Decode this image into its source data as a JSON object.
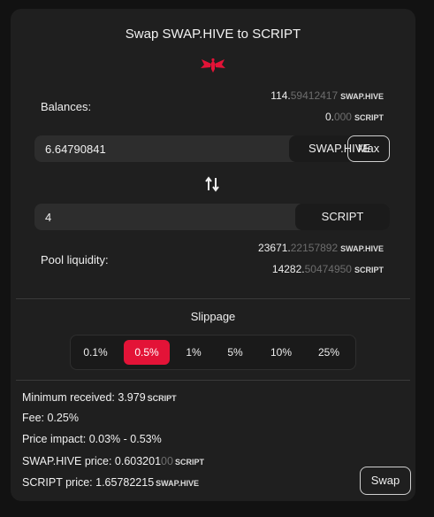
{
  "title": "Swap SWAP.HIVE to SCRIPT",
  "brand_color": "#e31337",
  "balances": {
    "label": "Balances:",
    "hive": {
      "int": "114.",
      "dec": "59412417",
      "unit": "SWAP.HIVE"
    },
    "script": {
      "int": "0.",
      "dec": "000",
      "unit": "SCRIPT"
    }
  },
  "from": {
    "value": "6.64790841",
    "token": "SWAP.HIVE",
    "max_label": "Max"
  },
  "swap_icon": "swap-vertical-arrows-icon",
  "to": {
    "value": "4",
    "token": "SCRIPT"
  },
  "pool": {
    "label": "Pool liquidity:",
    "hive": {
      "int": "23671.",
      "dec": "22157892",
      "unit": "SWAP.HIVE"
    },
    "script": {
      "int": "14282.",
      "dec": "50474950",
      "unit": "SCRIPT"
    }
  },
  "slippage": {
    "title": "Slippage",
    "options": [
      "0.1%",
      "0.5%",
      "1%",
      "5%",
      "10%",
      "25%"
    ],
    "selected": "0.5%"
  },
  "info": {
    "min_received": {
      "label": "Minimum received: ",
      "value": "3.979",
      "unit": "SCRIPT"
    },
    "fee": "Fee: 0.25%",
    "price_impact": "Price impact: 0.03% - 0.53%",
    "hive_price": {
      "label": "SWAP.HIVE price: ",
      "value": "0.603201",
      "dim": "00",
      "unit": "SCRIPT"
    },
    "script_price": {
      "label": "SCRIPT price: ",
      "value": "1.65782215",
      "unit": "SWAP.HIVE"
    }
  },
  "swap_label": "Swap"
}
